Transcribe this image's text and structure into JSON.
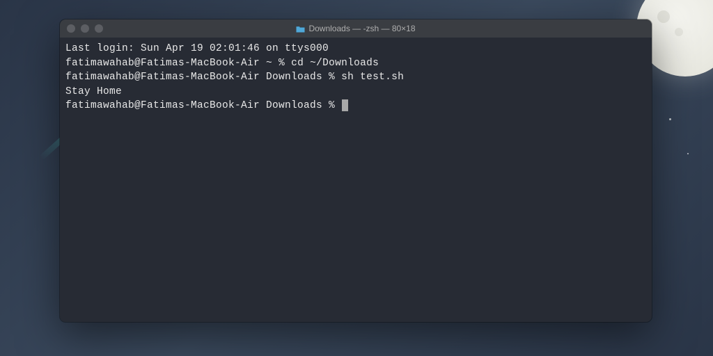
{
  "window": {
    "title": "Downloads — -zsh — 80×18"
  },
  "terminal": {
    "lastLogin": "Last login: Sun Apr 19 02:01:46 on ttys000",
    "line1_prompt": "fatimawahab@Fatimas-MacBook-Air ~ % ",
    "line1_cmd": "cd ~/Downloads",
    "line2_prompt": "fatimawahab@Fatimas-MacBook-Air Downloads % ",
    "line2_cmd": "sh test.sh",
    "output": "Stay Home",
    "line3_prompt": "fatimawahab@Fatimas-MacBook-Air Downloads % "
  }
}
